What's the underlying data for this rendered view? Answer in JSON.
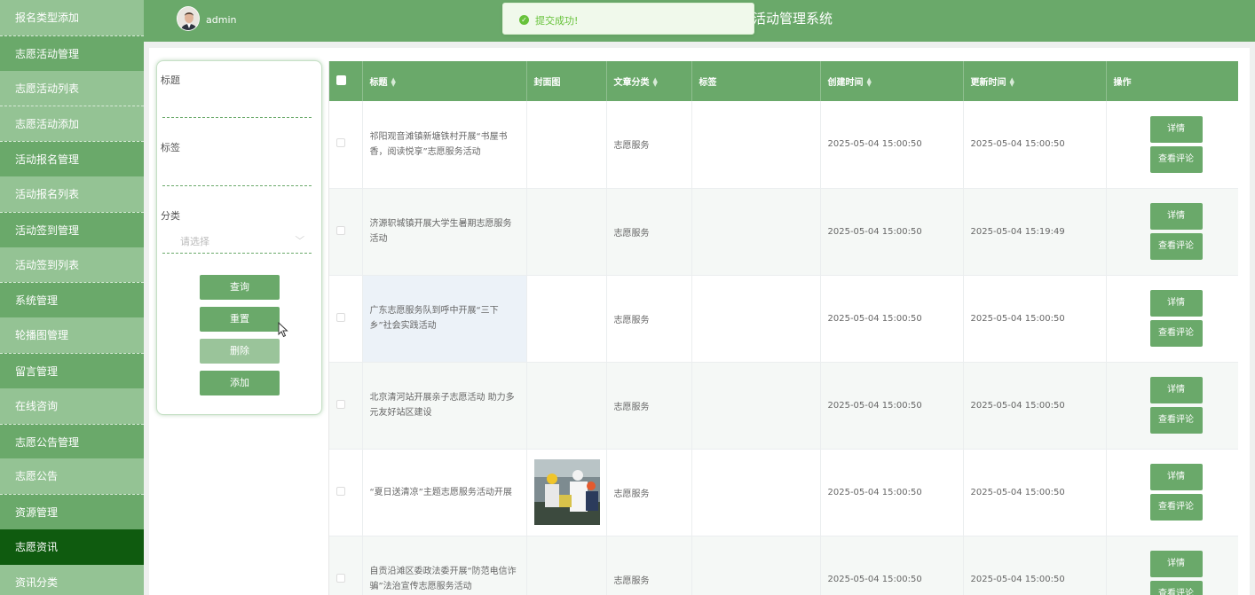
{
  "sidebar": {
    "items": [
      {
        "label": "报名类型添加",
        "kind": "sub"
      },
      {
        "label": "志愿活动管理",
        "kind": "group"
      },
      {
        "label": "志愿活动列表",
        "kind": "sub"
      },
      {
        "label": "志愿活动添加",
        "kind": "sub"
      },
      {
        "label": "活动报名管理",
        "kind": "group"
      },
      {
        "label": "活动报名列表",
        "kind": "sub"
      },
      {
        "label": "活动签到管理",
        "kind": "group"
      },
      {
        "label": "活动签到列表",
        "kind": "sub"
      },
      {
        "label": "系统管理",
        "kind": "group"
      },
      {
        "label": "轮播图管理",
        "kind": "sub"
      },
      {
        "label": "留言管理",
        "kind": "group"
      },
      {
        "label": "在线咨询",
        "kind": "sub"
      },
      {
        "label": "志愿公告管理",
        "kind": "group"
      },
      {
        "label": "志愿公告",
        "kind": "sub"
      },
      {
        "label": "资源管理",
        "kind": "group"
      },
      {
        "label": "志愿资讯",
        "kind": "active"
      },
      {
        "label": "资讯分类",
        "kind": "sub"
      }
    ]
  },
  "header": {
    "user": "admin",
    "title": "活动管理系统"
  },
  "toast": {
    "message": "提交成功!",
    "icon": "check-circle-icon",
    "color": "#67c23a"
  },
  "search": {
    "title_label": "标题",
    "tag_label": "标签",
    "category_label": "分类",
    "category_placeholder": "请选择",
    "query_button": "查询",
    "reset_button": "重置",
    "delete_button": "删除",
    "add_button": "添加"
  },
  "table": {
    "headers": {
      "title": "标题",
      "cover": "封面图",
      "category": "文章分类",
      "tags": "标签",
      "created": "创建时间",
      "updated": "更新时间",
      "ops": "操作"
    },
    "detail_label": "详情",
    "comments_label": "查看评论",
    "rows": [
      {
        "title": "祁阳观音滩镇新塘铁村开展“书屋书香，阅读悦享”志愿服务活动",
        "category": "志愿服务",
        "tags": "",
        "created": "2025-05-04 15:00:50",
        "updated": "2025-05-04 15:00:50",
        "has_cover": false
      },
      {
        "title": "济源轵城镇开展大学生暑期志愿服务活动",
        "category": "志愿服务",
        "tags": "",
        "created": "2025-05-04 15:00:50",
        "updated": "2025-05-04 15:19:49",
        "has_cover": false
      },
      {
        "title": "广东志愿服务队到呼中开展“三下乡”社会实践活动",
        "category": "志愿服务",
        "tags": "",
        "created": "2025-05-04 15:00:50",
        "updated": "2025-05-04 15:00:50",
        "has_cover": false
      },
      {
        "title": "北京清河站开展亲子志愿活动 助力多元友好站区建设",
        "category": "志愿服务",
        "tags": "",
        "created": "2025-05-04 15:00:50",
        "updated": "2025-05-04 15:00:50",
        "has_cover": false
      },
      {
        "title": "“夏日送清凉”主题志愿服务活动开展",
        "category": "志愿服务",
        "tags": "",
        "created": "2025-05-04 15:00:50",
        "updated": "2025-05-04 15:00:50",
        "has_cover": true
      },
      {
        "title": "自贡沿滩区委政法委开展“防范电信诈骗”法治宣传志愿服务活动",
        "category": "志愿服务",
        "tags": "",
        "created": "2025-05-04 15:00:50",
        "updated": "2025-05-04 15:00:50",
        "has_cover": false
      }
    ]
  },
  "colors": {
    "primary": "#6aa96a",
    "active_menu": "#0f5b0f",
    "sub_menu": "#94c394"
  }
}
